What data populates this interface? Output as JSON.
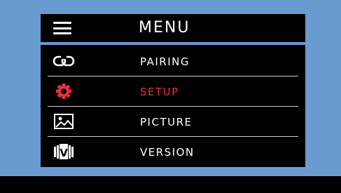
{
  "header": {
    "menu_icon": "hamburger-icon",
    "title": "MENU"
  },
  "menu": {
    "items": [
      {
        "label": "PAIRING",
        "icon": "link-icon",
        "active": false
      },
      {
        "label": "SETUP",
        "icon": "gear-icon",
        "active": true
      },
      {
        "label": "PICTURE",
        "icon": "image-icon",
        "active": false
      },
      {
        "label": "VERSION",
        "icon": "version-icon",
        "active": false
      }
    ]
  },
  "colors": {
    "background": "#6a9bd0",
    "panel": "#000000",
    "text": "#ffffff",
    "active": "#e8303a",
    "divider": "#cfcfcf"
  }
}
